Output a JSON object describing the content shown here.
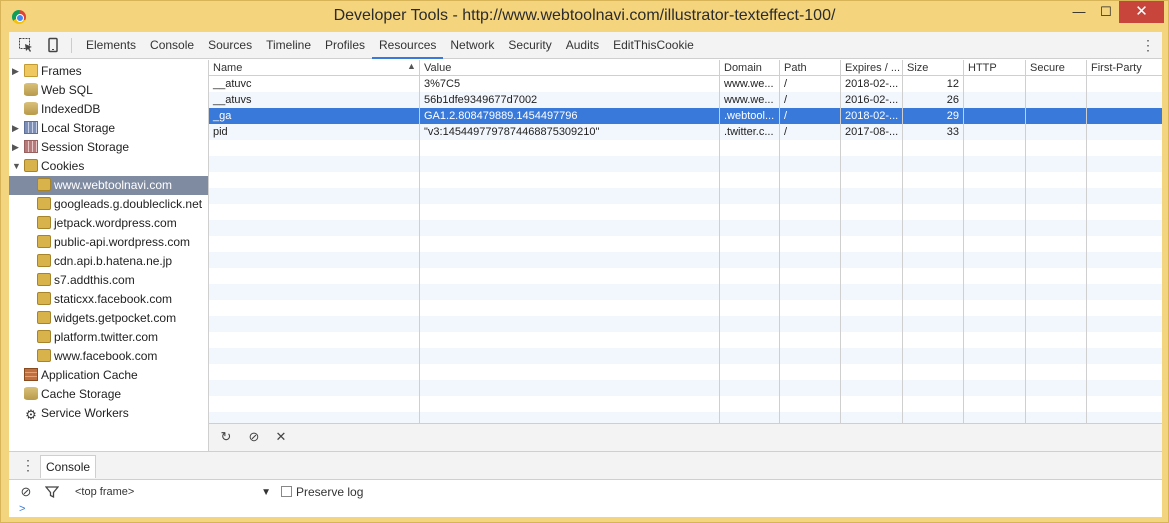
{
  "window": {
    "title": "Developer Tools - http://www.webtoolnavi.com/illustrator-texteffect-100/",
    "minimize": "—",
    "maximize": "☐",
    "close": "✕"
  },
  "toolbar": {
    "tabs": [
      "Elements",
      "Console",
      "Sources",
      "Timeline",
      "Profiles",
      "Resources",
      "Network",
      "Security",
      "Audits",
      "EditThisCookie"
    ],
    "active_tab": "Resources"
  },
  "sidebar": {
    "frames": "Frames",
    "websql": "Web SQL",
    "indexeddb": "IndexedDB",
    "local_storage": "Local Storage",
    "session_storage": "Session Storage",
    "cookies": "Cookies",
    "cookie_domains": [
      "www.webtoolnavi.com",
      "googleads.g.doubleclick.net",
      "jetpack.wordpress.com",
      "public-api.wordpress.com",
      "cdn.api.b.hatena.ne.jp",
      "s7.addthis.com",
      "staticxx.facebook.com",
      "widgets.getpocket.com",
      "platform.twitter.com",
      "www.facebook.com"
    ],
    "app_cache": "Application Cache",
    "cache_storage": "Cache Storage",
    "service_workers": "Service Workers"
  },
  "table": {
    "headers": [
      "Name",
      "Value",
      "Domain",
      "Path",
      "Expires / ...",
      "Size",
      "HTTP",
      "Secure",
      "First-Party"
    ],
    "rows": [
      {
        "name": "__atuvc",
        "value": "3%7C5",
        "domain": "www.we...",
        "path": "/",
        "expires": "2018-02-...",
        "size": "12"
      },
      {
        "name": "__atuvs",
        "value": "56b1dfe9349677d7002",
        "domain": "www.we...",
        "path": "/",
        "expires": "2016-02-...",
        "size": "26"
      },
      {
        "name": "_ga",
        "value": "GA1.2.808479889.1454497796",
        "domain": ".webtool...",
        "path": "/",
        "expires": "2018-02-...",
        "size": "29"
      },
      {
        "name": "pid",
        "value": "\"v3:1454497797874468875309210\"",
        "domain": ".twitter.c...",
        "path": "/",
        "expires": "2017-08-...",
        "size": "33"
      }
    ],
    "selected_row": 2
  },
  "drawer": {
    "tab": "Console",
    "frame_select": "<top frame>",
    "preserve_log": "Preserve log",
    "prompt": ">"
  }
}
